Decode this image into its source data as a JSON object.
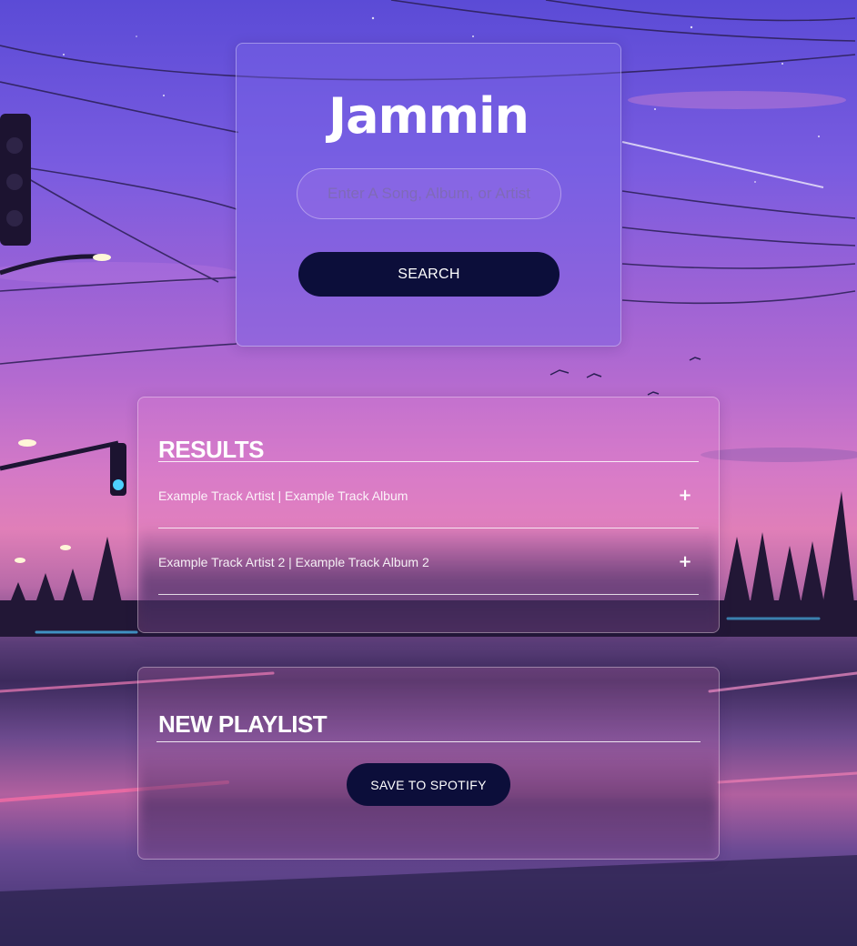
{
  "app": {
    "logo_text": "Jammin"
  },
  "search": {
    "placeholder": "Enter A Song, Album, or Artist",
    "value": "",
    "button_label": "SEARCH"
  },
  "results": {
    "title": "RESULTS",
    "tracks": [
      {
        "label": "Example Track Artist | Example Track Album",
        "action": "+"
      },
      {
        "label": "Example Track Artist 2 | Example Track Album 2",
        "action": "+"
      }
    ]
  },
  "playlist": {
    "title": "NEW PLAYLIST",
    "save_label": "SAVE TO SPOTIFY"
  },
  "colors": {
    "button_bg": "#0c0e3a",
    "text": "#ffffff",
    "sky_top": "#5b4bd6",
    "sky_horizon": "#e07fb8"
  }
}
